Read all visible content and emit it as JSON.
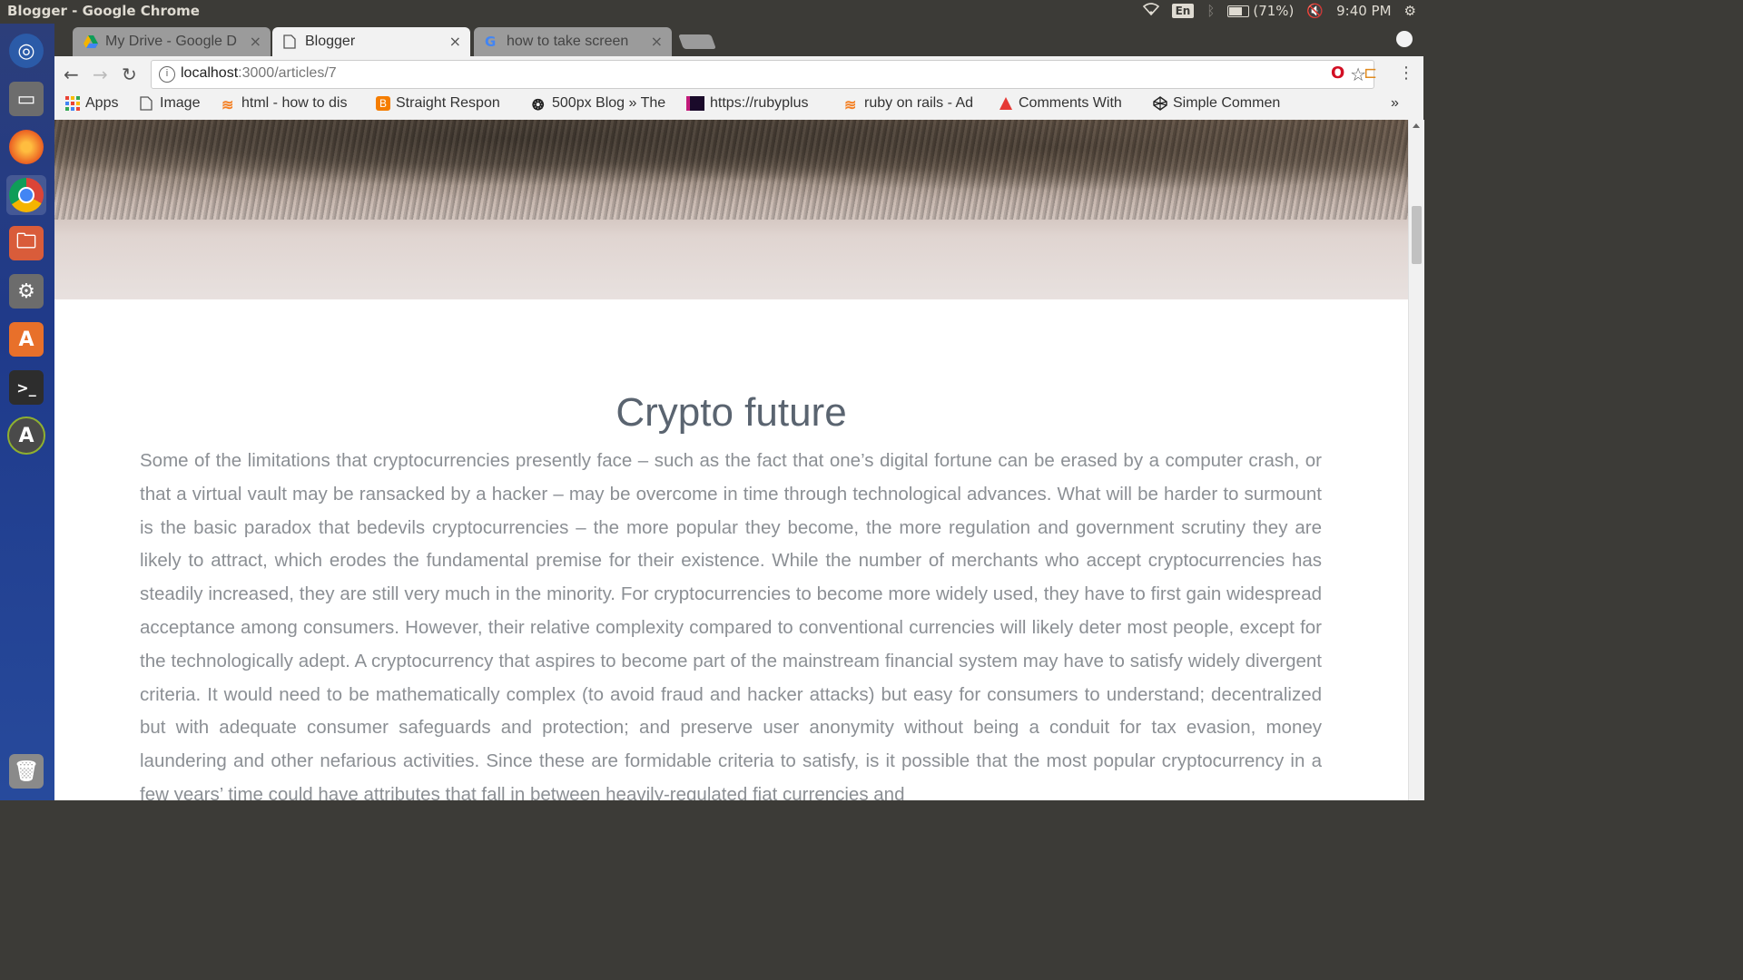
{
  "window": {
    "title": "Blogger - Google Chrome"
  },
  "tray": {
    "lang": "En",
    "battery": "(71%)",
    "time": "9:40 PM"
  },
  "launcher": {
    "items": [
      "ubuntu-dash-icon",
      "files-icon",
      "firefox-icon",
      "chrome-icon",
      "file-manager-icon",
      "system-settings-icon",
      "software-center-icon",
      "terminal-icon",
      "updater-icon",
      "trash-icon"
    ]
  },
  "tabs": [
    {
      "label": "My Drive - Google D",
      "icon": "google-drive-icon",
      "active": false
    },
    {
      "label": "Blogger",
      "icon": "page-icon",
      "active": true
    },
    {
      "label": "how to take screen",
      "icon": "google-icon",
      "active": false
    }
  ],
  "omnibox": {
    "host": "localhost",
    "path": ":3000/articles/7"
  },
  "bookmarks": [
    {
      "label": "Apps",
      "icon": "apps-grid-icon"
    },
    {
      "label": "Image",
      "icon": "page-icon"
    },
    {
      "label": "html - how to dis",
      "icon": "stackoverflow-icon"
    },
    {
      "label": "Straight Respon",
      "icon": "blogger-icon"
    },
    {
      "label": "500px Blog » The",
      "icon": "500px-icon"
    },
    {
      "label": "https://rubyplus",
      "icon": "rubyplus-icon"
    },
    {
      "label": "ruby on rails - Ad",
      "icon": "stackoverflow-icon"
    },
    {
      "label": "Comments With",
      "icon": "red-triangle-icon"
    },
    {
      "label": "Simple Commen",
      "icon": "codepen-icon"
    }
  ],
  "bookmarks_overflow": "»",
  "article": {
    "title": "Crypto future",
    "body": "Some of the limitations that cryptocurrencies presently face – such as the fact that one’s digital fortune can be erased by a computer crash, or that a virtual vault may be ransacked by a hacker – may be overcome in time through technological advances. What will be harder to surmount is the basic paradox that bedevils cryptocurrencies – the more popular they become, the more regulation and government scrutiny they are likely to attract, which erodes the fundamental premise for their existence. While the number of merchants who accept cryptocurrencies has steadily increased, they are still very much in the minority. For cryptocurrencies to become more widely used, they have to first gain widespread acceptance among consumers. However, their relative complexity compared to conventional currencies will likely deter most people, except for the technologically adept. A cryptocurrency that aspires to become part of the mainstream financial system may have to satisfy widely divergent criteria. It would need to be mathematically complex (to avoid fraud and hacker attacks) but easy for consumers to understand; decentralized but with adequate consumer safeguards and protection; and preserve user anonymity without being a conduit for tax evasion, money laundering and other nefarious activities. Since these are formidable criteria to satisfy, is it possible that the most popular cryptocurrency in a few years’ time could have attributes that fall in between heavily-regulated fiat currencies and"
  },
  "colors": {
    "title": "#5a6470",
    "body": "#8b8f94",
    "chrome_dark": "#3c3b37",
    "launcher": "#1f3a8a"
  }
}
